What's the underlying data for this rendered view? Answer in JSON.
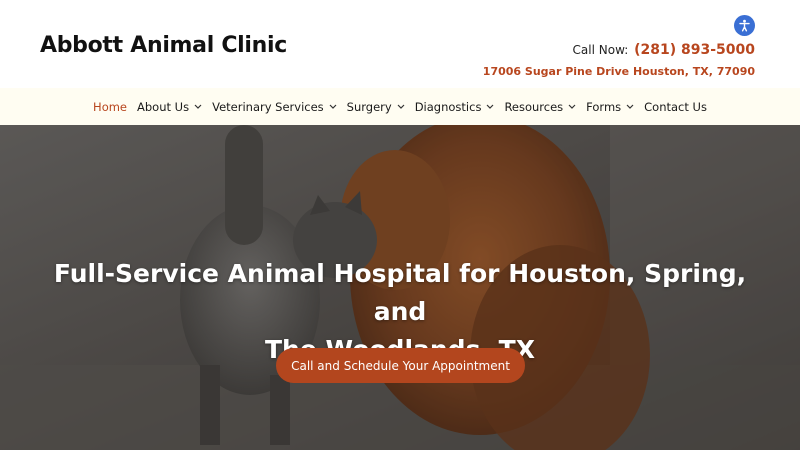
{
  "header": {
    "logo_text": "Abbott Animal Clinic",
    "call_label": "Call Now:",
    "phone": "(281) 893-5000",
    "address": "17006 Sugar Pine Drive Houston, TX, 77090",
    "accessibility_icon": "accessibility-icon"
  },
  "nav": {
    "items": [
      {
        "label": "Home",
        "active": true
      },
      {
        "label": "About Us",
        "dropdown": true
      },
      {
        "label": "Veterinary Services",
        "dropdown": true
      },
      {
        "label": "Surgery",
        "dropdown": true
      },
      {
        "label": "Diagnostics",
        "dropdown": true
      },
      {
        "label": "Resources",
        "dropdown": true
      },
      {
        "label": "Forms",
        "dropdown": true
      },
      {
        "label": "Contact Us"
      }
    ]
  },
  "hero": {
    "title_line1": "Full-Service Animal Hospital for Houston, Spring, and",
    "title_line2": "The Woodlands, TX",
    "cta_label": "Call and Schedule Your Appointment"
  },
  "colors": {
    "accent": "#b8461e",
    "nav_background": "#fffdf2",
    "accessibility_button": "#3a6fd4"
  }
}
